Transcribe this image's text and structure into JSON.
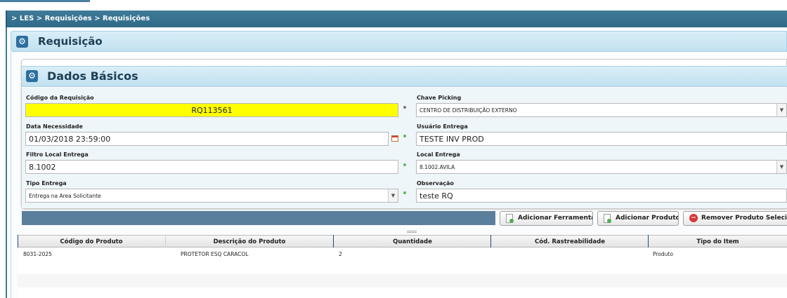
{
  "breadcrumb": "> LES > Requisições > Requisições",
  "page": {
    "title": "Requisição",
    "icon": "gear-icon"
  },
  "section": {
    "title": "Dados Básicos",
    "icon": "gear-icon"
  },
  "form": {
    "codigo_label": "Código da Requisição",
    "codigo_value": "RQ113561",
    "chave_label": "Chave Picking",
    "chave_value": "CENTRO DE DISTRIBUIÇÃO EXTERNO",
    "data_label": "Data Necessidade",
    "data_value": "01/03/2018 23:59:00",
    "usuario_label": "Usuário Entrega",
    "usuario_value": "TESTE INV PROD",
    "filtro_label": "Filtro Local Entrega",
    "filtro_value": "8.1002",
    "local_label": "Local Entrega",
    "local_value": "8.1002.AVILA",
    "tipo_label": "Tipo Entrega",
    "tipo_value": "Entrega na Area Solicitante",
    "obs_label": "Observação",
    "obs_value": "teste RQ"
  },
  "buttons": {
    "add_ferramenta": "Adicionar Ferramenta",
    "add_produto": "Adicionar Produto",
    "remove_produto": "Remover Produto Seleciona"
  },
  "grid": {
    "columns": [
      "Código do Produto",
      "Descrição do Produto",
      "Quantidade",
      "Cód. Rastreabilidade",
      "Tipo do Item"
    ],
    "rows": [
      [
        "8031-2025",
        "PROTETOR ESQ CARACOL",
        "2",
        "",
        "Produto"
      ]
    ]
  },
  "colors": {
    "highlight": "#ffff00",
    "header_blue": "#3f7b99",
    "toolbar": "#5a7f9c"
  }
}
